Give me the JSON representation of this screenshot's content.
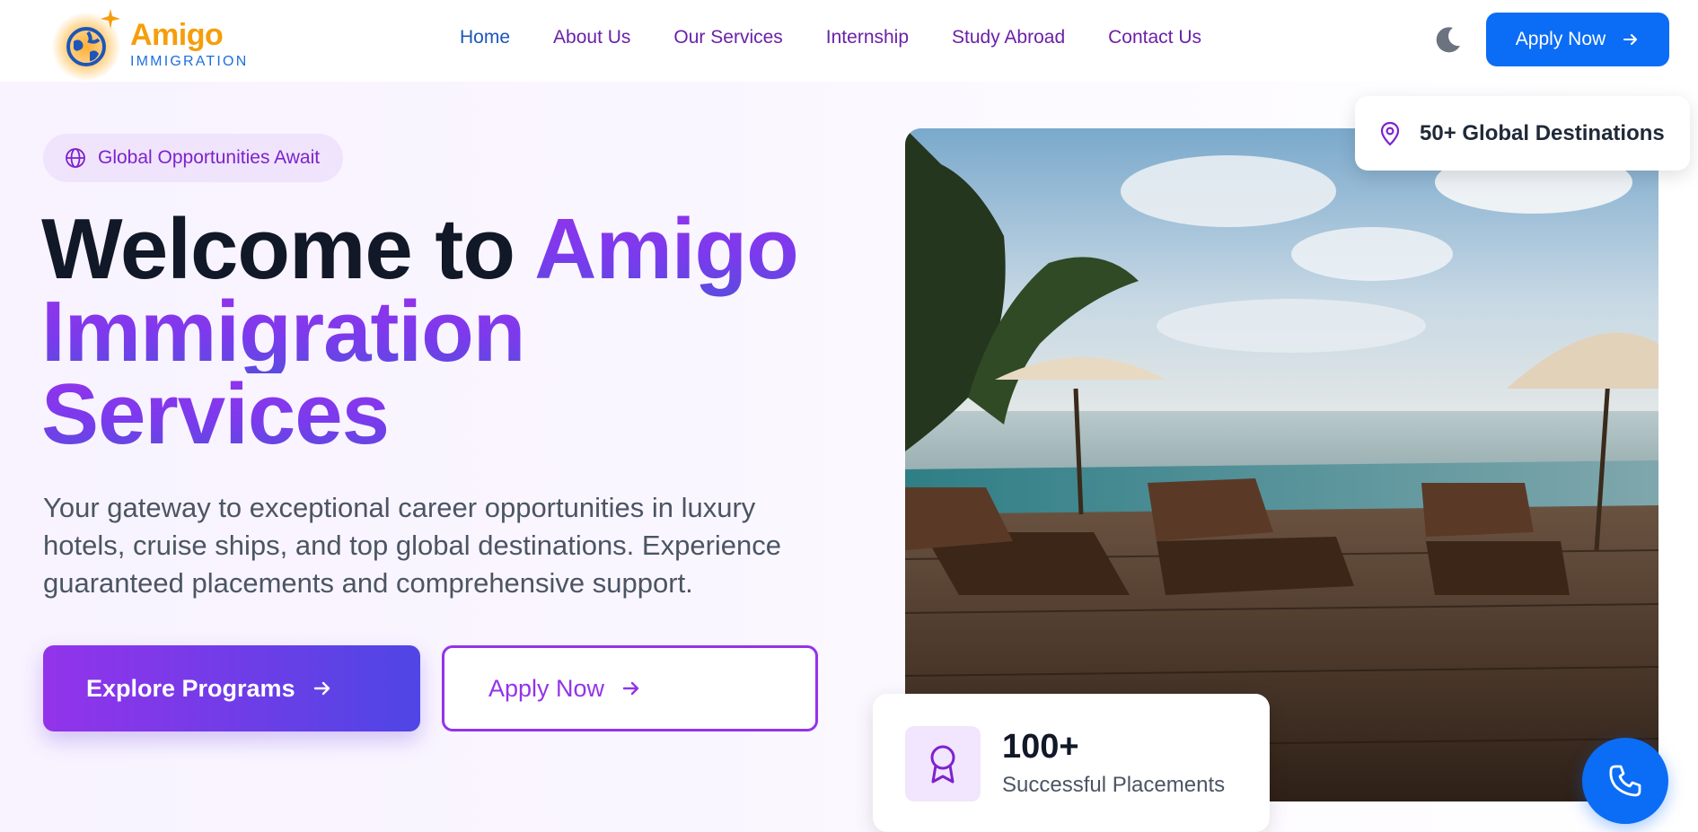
{
  "brand": {
    "name": "Amigo",
    "subtitle": "IMMIGRATION",
    "colors": {
      "primary": "#0b6df5",
      "accent": "#9333ea",
      "logo": "#f59e0b"
    }
  },
  "nav": {
    "items": [
      {
        "label": "Home",
        "active": true
      },
      {
        "label": "About Us",
        "active": false
      },
      {
        "label": "Our Services",
        "active": false
      },
      {
        "label": "Internship",
        "active": false
      },
      {
        "label": "Study Abroad",
        "active": false
      },
      {
        "label": "Contact Us",
        "active": false
      }
    ],
    "theme_toggle_icon": "moon-icon",
    "apply_label": "Apply Now"
  },
  "hero": {
    "badge": {
      "label": "Global Opportunities Await",
      "icon": "globe-icon"
    },
    "headline": {
      "prefix": "Welcome to ",
      "highlight_line1": "Amigo",
      "highlight_line2": "Immigration",
      "highlight_line3": "Services"
    },
    "description": "Your gateway to exceptional career opportunities in luxury hotels, cruise ships, and top global destinations. Experience guaranteed placements and comprehensive support.",
    "primary_button": {
      "label": "Explore Programs",
      "icon": "arrow-right-icon"
    },
    "secondary_button": {
      "label": "Apply Now",
      "icon": "arrow-right-icon"
    }
  },
  "image_panel": {
    "destinations_card": {
      "label": "50+ Global Destinations",
      "icon": "map-pin-icon"
    },
    "stats_card": {
      "value": "100+",
      "label": "Successful Placements",
      "icon": "award-icon"
    },
    "call_button_icon": "phone-icon"
  }
}
